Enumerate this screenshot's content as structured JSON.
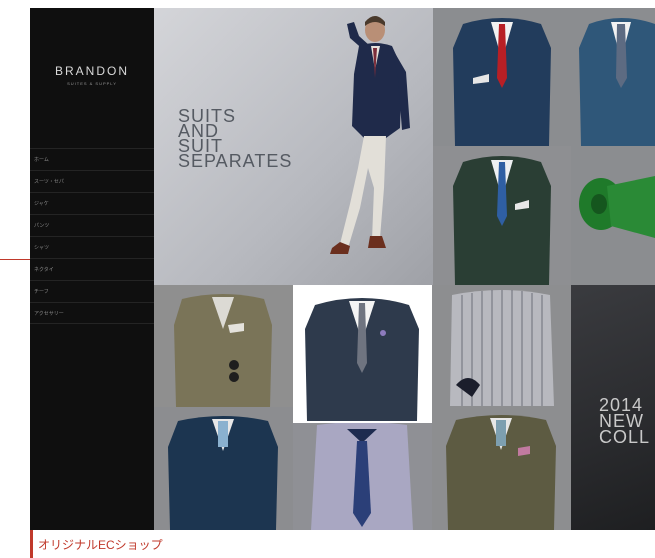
{
  "brand": {
    "name": "BRANDON",
    "subtitle": "SUITES & SUPPLY"
  },
  "nav": [
    {
      "label": "ホーム"
    },
    {
      "label": "スーツ・セパ"
    },
    {
      "label": "ジャケ"
    },
    {
      "label": "パンツ"
    },
    {
      "label": "シャツ"
    },
    {
      "label": "ネクタイ"
    },
    {
      "label": "チーフ"
    },
    {
      "label": "アクセサリー"
    }
  ],
  "hero": {
    "line1": "SUITS",
    "line2": "AND",
    "line3": "SUIT",
    "line4": "SEPARATES"
  },
  "promo": {
    "line1": "2014",
    "line2": "NEW",
    "line3": "COLL"
  },
  "caption": "オリジナルECショップ",
  "colors": {
    "accent": "#c0392b",
    "sidebar": "#0f0f0f",
    "frame": "#1a1a1a"
  }
}
